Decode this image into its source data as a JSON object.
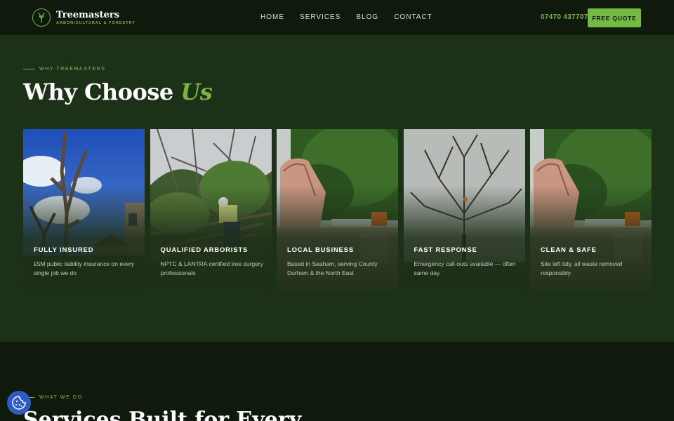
{
  "brand": {
    "name": "Treemasters",
    "tagline": "ARBORICULTURAL & FORESTRY",
    "accent_color": "#7cb342",
    "icon": "tree-logo-icon"
  },
  "nav": {
    "items": [
      {
        "label": "HOME"
      },
      {
        "label": "SERVICES"
      },
      {
        "label": "BLOG"
      },
      {
        "label": "CONTACT"
      }
    ]
  },
  "header": {
    "phone": "07470 437707",
    "cta_label": "FREE QUOTE"
  },
  "why": {
    "eyebrow": "WHY TREEMASTERS",
    "title_main": "Why Choose ",
    "title_accent": "Us",
    "cards": [
      {
        "title": "FULLY INSURED",
        "description": "£5M public liability insurance on every single job we do"
      },
      {
        "title": "QUALIFIED ARBORISTS",
        "description": "NPTC & LANTRA certified tree surgery professionals"
      },
      {
        "title": "LOCAL BUSINESS",
        "description": "Based in Seaham, serving County Durham & the North East"
      },
      {
        "title": "FAST RESPONSE",
        "description": "Emergency call-outs available — often same day"
      },
      {
        "title": "CLEAN & SAFE",
        "description": "Site left tidy, all waste removed responsibly"
      }
    ]
  },
  "services": {
    "eyebrow": "WHAT WE DO",
    "title": "Services Built for Every"
  },
  "cookie": {
    "icon": "cookie-icon"
  }
}
